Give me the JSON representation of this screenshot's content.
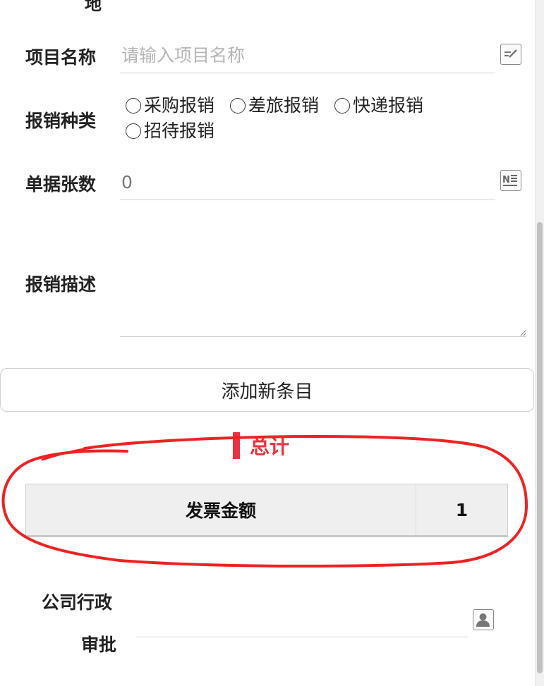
{
  "top_cutoff_label": "地",
  "project_name": {
    "label": "项目名称",
    "placeholder": "请输入项目名称",
    "icon": "edit-icon"
  },
  "reimburse_type": {
    "label": "报销种类",
    "options": [
      "采购报销",
      "差旅报销",
      "快递报销",
      "招待报销"
    ]
  },
  "receipt_count": {
    "label": "单据张数",
    "value": "0",
    "icon": "number-icon"
  },
  "description": {
    "label": "报销描述",
    "value": ""
  },
  "add_item_button": "添加新条目",
  "total": {
    "heading": "总计",
    "accent_color": "#e8323f",
    "rows": [
      {
        "label": "发票金额",
        "value": "1"
      }
    ]
  },
  "approval": {
    "label_line1": "公司行政",
    "label_line2": "审批",
    "icon": "user-icon"
  },
  "annotation_color": "#ee2222"
}
